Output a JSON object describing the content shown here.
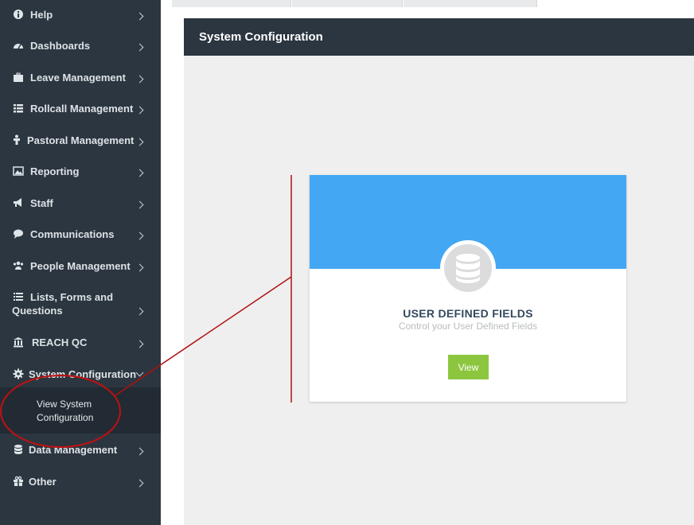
{
  "sidebar": {
    "items": [
      {
        "label": "Help",
        "icon": "info-icon"
      },
      {
        "label": "Dashboards",
        "icon": "dashboard-icon"
      },
      {
        "label": "Leave Management",
        "icon": "briefcase-icon"
      },
      {
        "label": "Rollcall Management",
        "icon": "table-icon"
      },
      {
        "label": "Pastoral Management",
        "icon": "person-icon"
      },
      {
        "label": "Reporting",
        "icon": "image-icon"
      },
      {
        "label": "Staff",
        "icon": "megaphone-icon"
      },
      {
        "label": "Communications",
        "icon": "comment-icon"
      },
      {
        "label": "People Management",
        "icon": "users-icon"
      },
      {
        "label_line1": "Lists, Forms and",
        "label_line2": "Questions",
        "icon": "list-icon"
      },
      {
        "label": "REACH QC",
        "icon": "bank-icon"
      },
      {
        "label": "System Configuration",
        "icon": "gear-icon"
      },
      {
        "label": "Data Management",
        "icon": "database-icon"
      },
      {
        "label": "Other",
        "icon": "gift-icon"
      }
    ],
    "submenu": {
      "label_line1": "View System",
      "label_line2": "Configuration"
    }
  },
  "panel": {
    "title": "System Configuration"
  },
  "card": {
    "title": "USER DEFINED FIELDS",
    "subtitle": "Control your User Defined Fields",
    "button_label": "View",
    "icon": "database-icon"
  },
  "colors": {
    "sidebar_bg": "#2b3640",
    "card_header": "#44a7f3",
    "button": "#8cc63f",
    "annotation": "#b01010"
  }
}
